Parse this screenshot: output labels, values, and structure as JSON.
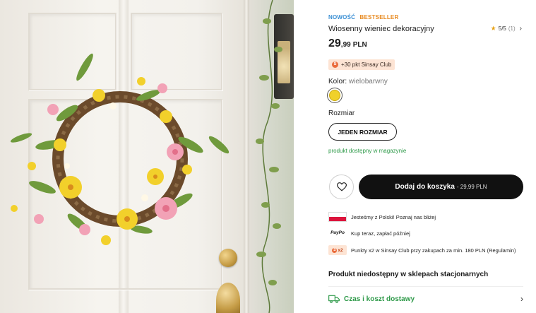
{
  "product": {
    "badge_new": "NOWOŚĆ",
    "badge_bestseller": "BESTSELLER",
    "title": "Wiosenny wieniec dekoracyjny",
    "rating": {
      "star": "★",
      "value": "5/5",
      "count": "(1)"
    },
    "price": {
      "integer": "29",
      "decimal": ",99",
      "currency": "PLN"
    },
    "club_points": "+30 pkt Sinsay Club",
    "color_label": "Kolor:",
    "color_value": "wielobarwny",
    "swatch_color": "#f0d12a",
    "size_label": "Rozmiar",
    "size_option": "JEDEN ROZMIAR",
    "availability": "produkt dostępny w magazynie"
  },
  "actions": {
    "add_to_cart_label": "Dodaj do koszyka",
    "add_to_cart_price": "- 29,99 PLN",
    "wishlist_icon": "heart-icon"
  },
  "features": [
    {
      "icon": "poland-flag-icon",
      "text": "Jesteśmy z Polski! Poznaj nas bliżej"
    },
    {
      "icon": "paypo-icon",
      "icon_text": "PayPo",
      "text": "Kup teraz, zapłać później"
    },
    {
      "icon": "x2-points-icon",
      "icon_text": "x2",
      "text": "Punkty x2 w Sinsay Club przy zakupach za min. 180 PLN (Regulamin)"
    }
  ],
  "store_availability": "Produkt niedostępny w sklepach stacjonarnych",
  "delivery_label": "Czas i koszt dostawy",
  "colors": {
    "accent_green": "#2f9a4a",
    "badge_blue": "#3a8fd4",
    "badge_orange": "#e8891e",
    "club_bg": "#fde4d4",
    "button_black": "#111111"
  }
}
